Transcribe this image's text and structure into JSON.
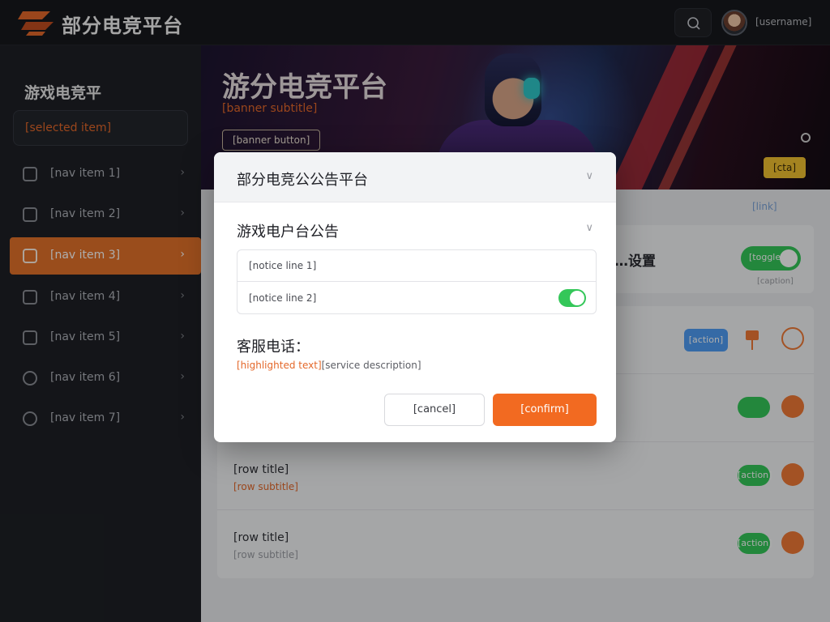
{
  "header": {
    "app_title": "部分电竞平台",
    "username": "[username]"
  },
  "sidebar": {
    "title": "游戏电竞平",
    "select_value": "[selected item]",
    "items": [
      {
        "label": "[nav item 1]",
        "active": false
      },
      {
        "label": "[nav item 2]",
        "active": false
      },
      {
        "label": "[nav item 3]",
        "active": true
      },
      {
        "label": "[nav item 4]",
        "active": false
      },
      {
        "label": "[nav item 5]",
        "active": false
      },
      {
        "label": "[nav item 6]",
        "active": false
      },
      {
        "label": "[nav item 7]",
        "active": false
      }
    ]
  },
  "banner": {
    "title": "游分电竞平台",
    "subtitle": "[banner subtitle]",
    "button": "[banner button]",
    "cta": "[cta]"
  },
  "content": {
    "link": "[link]",
    "settings_title": "…设置",
    "settings_toggle": "[toggle]",
    "settings_sub": "[caption]",
    "rows": [
      {
        "title": "",
        "sub": "",
        "action": "[action]"
      },
      {
        "title": "",
        "sub": "",
        "action": ""
      },
      {
        "title": "[row title]",
        "sub": "[row subtitle]",
        "action": "[action]"
      },
      {
        "title": "[row title]",
        "sub": "[row subtitle]",
        "action": "[action]"
      }
    ]
  },
  "modal": {
    "title": "部分电竞公公告平台",
    "section_title": "游戏电户台公告",
    "notice_line1": "[notice line 1]",
    "notice_line2": "[notice line 2]",
    "service_title": "客服电话：",
    "service_highlight": "[highlighted text]",
    "service_desc": "[service description]",
    "cancel_label": "[cancel]",
    "confirm_label": "[confirm]"
  },
  "colors": {
    "accent": "#f26a21",
    "toggle_on": "#34c759",
    "link_blue": "#4f9df5"
  }
}
